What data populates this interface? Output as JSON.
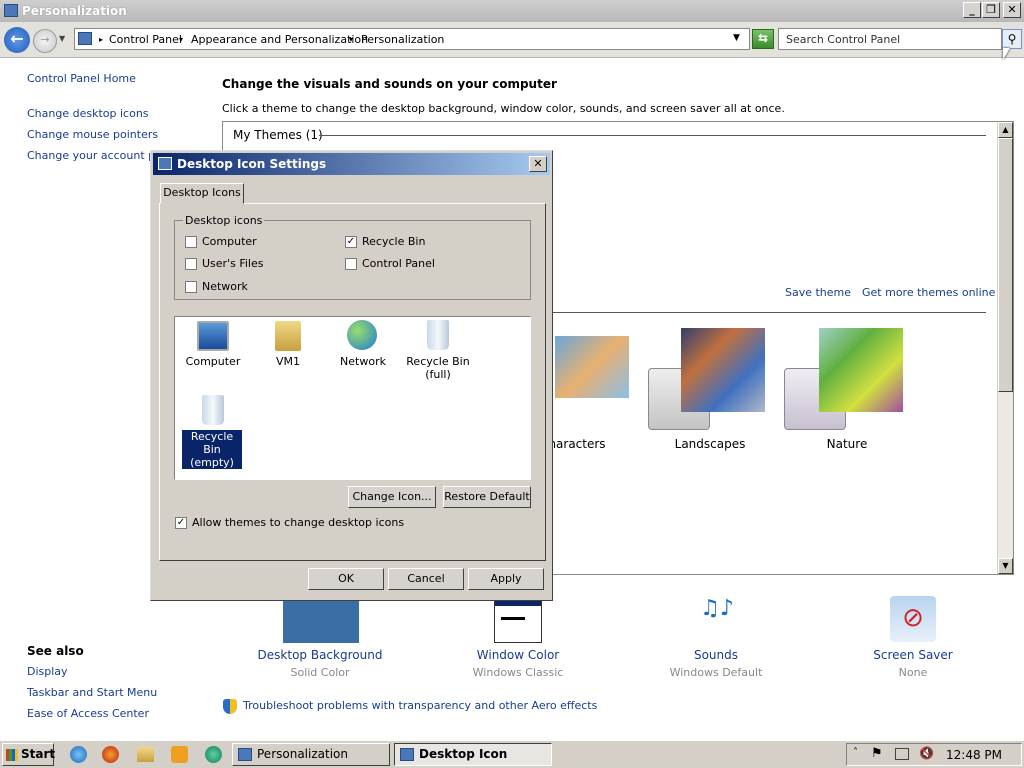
{
  "window": {
    "title": "Personalization"
  },
  "address": {
    "crumb1": "Control Panel",
    "crumb2": "Appearance and Personalization",
    "crumb3": "Personalization",
    "search_placeholder": "Search Control Panel"
  },
  "sidebar": {
    "home": "Control Panel Home",
    "links": [
      "Change desktop icons",
      "Change mouse pointers",
      "Change your account pict"
    ],
    "see_also": "See also",
    "see_links": [
      "Display",
      "Taskbar and Start Menu",
      "Ease of Access Center"
    ]
  },
  "main": {
    "heading": "Change the visuals and sounds on your computer",
    "subheading": "Click a theme to change the desktop background, window color, sounds, and screen saver all at once.",
    "my_themes": "My Themes (1)",
    "save_theme": "Save theme",
    "get_more": "Get more themes online",
    "themes": [
      "haracters",
      "Landscapes",
      "Nature"
    ],
    "bottom": [
      {
        "label": "Desktop Background",
        "sub": "Solid Color"
      },
      {
        "label": "Window Color",
        "sub": "Windows Classic"
      },
      {
        "label": "Sounds",
        "sub": "Windows Default"
      },
      {
        "label": "Screen Saver",
        "sub": "None"
      }
    ],
    "troubleshoot": "Troubleshoot problems with transparency and other Aero effects"
  },
  "dialog": {
    "title": "Desktop Icon Settings",
    "tab": "Desktop Icons",
    "group": "Desktop icons",
    "checkboxes": [
      {
        "label": "Computer",
        "checked": false
      },
      {
        "label": "Recycle Bin",
        "checked": true
      },
      {
        "label": "User's Files",
        "checked": false
      },
      {
        "label": "Control Panel",
        "checked": false
      },
      {
        "label": "Network",
        "checked": false
      }
    ],
    "icons": [
      "Computer",
      "VM1",
      "Network",
      "Recycle Bin (full)",
      "Recycle Bin (empty)"
    ],
    "change_icon": "Change Icon...",
    "restore": "Restore Default",
    "allow_themes": "Allow themes to change desktop icons",
    "ok": "OK",
    "cancel": "Cancel",
    "apply": "Apply"
  },
  "taskbar": {
    "start": "Start",
    "tasks": [
      "Personalization",
      "Desktop Icon Settings"
    ],
    "clock": "12:48 PM"
  }
}
